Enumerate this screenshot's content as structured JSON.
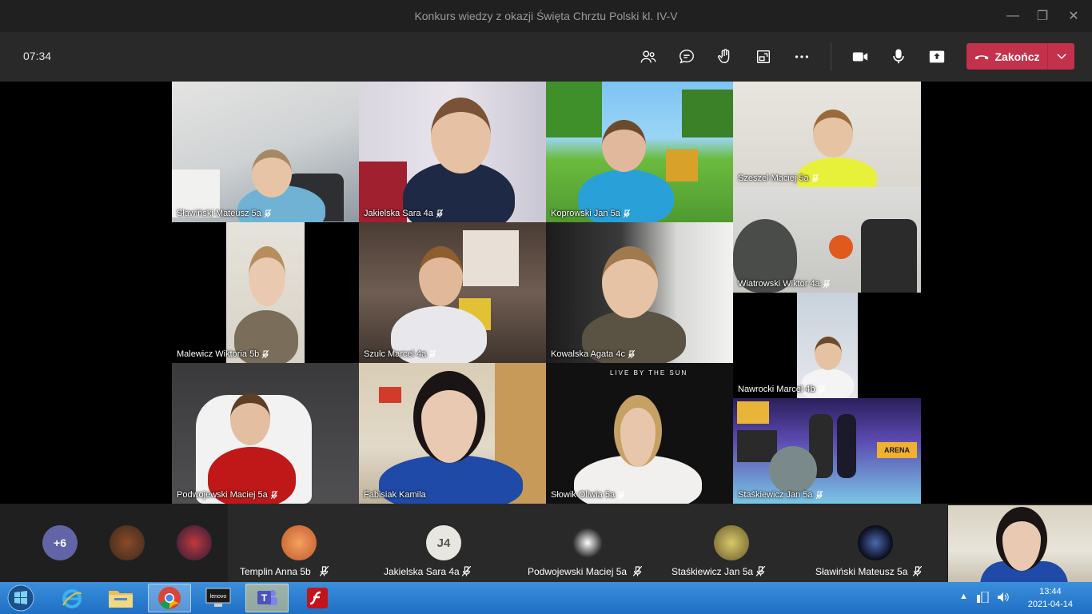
{
  "window": {
    "title": "Konkurs wiedzy z okazji Święta Chrztu Polski kl. IV-V",
    "minimize": "—",
    "maximize": "❐",
    "close": "✕"
  },
  "toolbar": {
    "timer": "07:34",
    "icons": [
      "people-icon",
      "chat-icon",
      "raise-hand-icon",
      "share-tray-icon",
      "more-icon",
      "camera-icon",
      "mic-icon",
      "share-screen-icon"
    ],
    "end_label": "Zakończ",
    "end_color": "#c4314b"
  },
  "tiles": [
    {
      "name": "Sławiński Mateusz 5a"
    },
    {
      "name": "Jakielska Sara 4a"
    },
    {
      "name": "Koprowski Jan 5a"
    },
    {
      "name": "Szeszel Maciej 5a"
    },
    {
      "name": "Wiatrowski Wiktor 4a"
    },
    {
      "name": "Malewicz Wiktoria 5b"
    },
    {
      "name": "Szulc Marcel 4a"
    },
    {
      "name": "Kowalska Agata 4c"
    },
    {
      "name": "Nawrocki Marcel 4b"
    },
    {
      "name": "Podwojewski Maciej 5a"
    },
    {
      "name": "Fabisiak Kamila"
    },
    {
      "name": "Słowik Oliwia 5a"
    },
    {
      "name": "Staśkiewicz Jan 5a"
    }
  ],
  "tile_overlays": {
    "slowik_text": "LIVE BY THE SUN",
    "fortnite_text": "ARENA"
  },
  "tray": {
    "overflow": "+6",
    "participants": [
      {
        "name": "Templin Anna 5b",
        "initials": ""
      },
      {
        "name": "Jakielska Sara 4a",
        "initials": "J4"
      },
      {
        "name": "Podwojewski Maciej 5a",
        "initials": ""
      },
      {
        "name": "Staśkiewicz Jan 5a",
        "initials": ""
      },
      {
        "name": "Sławiński Mateusz 5a",
        "initials": ""
      }
    ]
  },
  "taskbar": {
    "time": "13:44",
    "date": "2021-04-14",
    "apps": [
      "windows-start-icon",
      "internet-explorer-icon",
      "file-explorer-icon",
      "chrome-icon",
      "lenovo-icon",
      "teams-icon",
      "flash-icon"
    ],
    "lenovo_label": "lenovo",
    "teams_label": "T"
  }
}
